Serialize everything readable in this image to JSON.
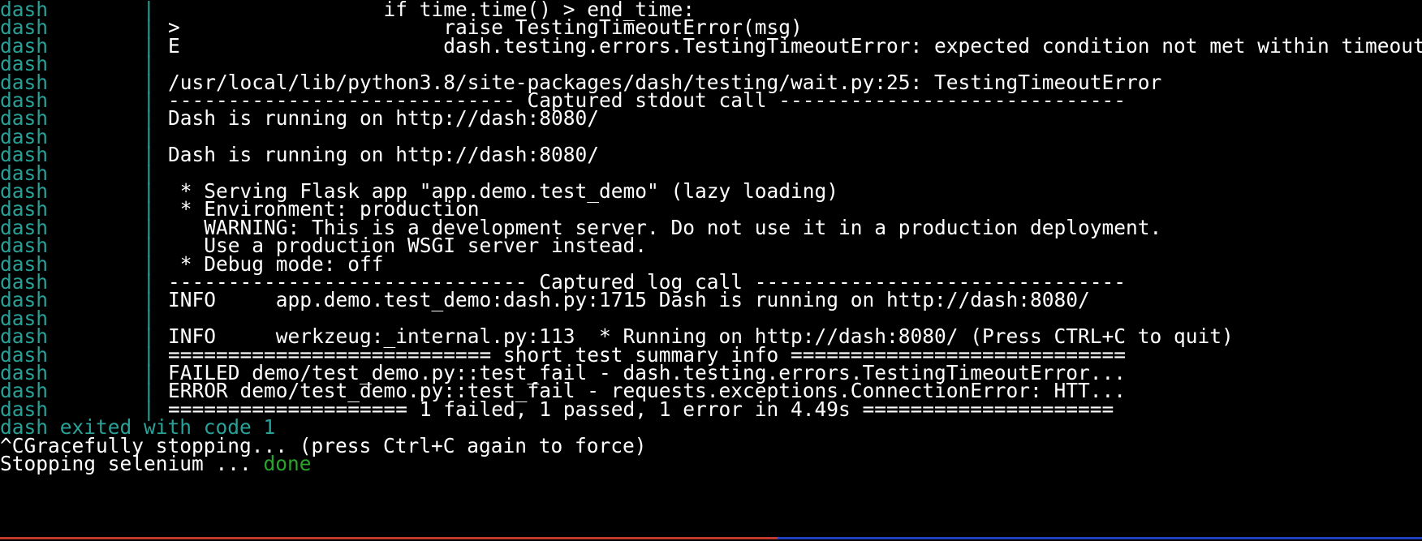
{
  "prefix": "dash",
  "separator": "|",
  "colors": {
    "background": "#000000",
    "prefix": "#2aa198",
    "text": "#ffffff",
    "done": "#2aa32b",
    "statusbar_left": "#c0392b",
    "statusbar_right": "#1f3fbf"
  },
  "log_lines": [
    "                  if time.time() > end_time:",
    ">                      raise TestingTimeoutError(msg)",
    "E                      dash.testing.errors.TestingTimeoutError: expected condition not met within timeout",
    "",
    "/usr/local/lib/python3.8/site-packages/dash/testing/wait.py:25: TestingTimeoutError",
    "----------------------------- Captured stdout call -----------------------------",
    "Dash is running on http://dash:8080/",
    "",
    "Dash is running on http://dash:8080/",
    "",
    " * Serving Flask app \"app.demo.test_demo\" (lazy loading)",
    " * Environment: production",
    "   WARNING: This is a development server. Do not use it in a production deployment.",
    "   Use a production WSGI server instead.",
    " * Debug mode: off",
    "------------------------------ Captured log call -------------------------------",
    "INFO     app.demo.test_demo:dash.py:1715 Dash is running on http://dash:8080/",
    "",
    "INFO     werkzeug:_internal.py:113  * Running on http://dash:8080/ (Press CTRL+C to quit)",
    "=========================== short test summary info ============================",
    "FAILED demo/test_demo.py::test_fail - dash.testing.errors.TestingTimeoutError...",
    "ERROR demo/test_demo.py::test_fail - requests.exceptions.ConnectionError: HTT...",
    "==================== 1 failed, 1 passed, 1 error in 4.49s ====================="
  ],
  "exit_line": "dash exited with code 1",
  "stop_line": "^CGracefully stopping... (press Ctrl+C again to force)",
  "selenium_line": {
    "text": "Stopping selenium ... ",
    "status": "done"
  }
}
